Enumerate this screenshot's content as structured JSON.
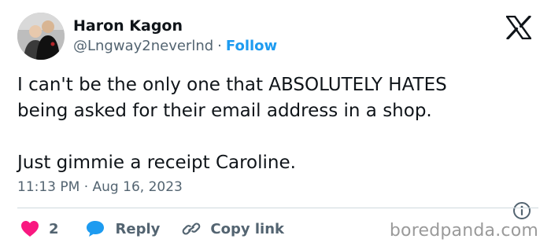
{
  "author": {
    "display_name": "Haron Kagon",
    "handle": "@Lngway2neverlnd",
    "separator": "·",
    "follow_label": "Follow"
  },
  "tweet": {
    "text": "I can't be the only one that ABSOLUTELY HATES\nbeing asked for their email address in a shop.\n\nJust gimmie a receipt Caroline.",
    "timestamp": "11:13 PM · Aug 16, 2023"
  },
  "actions": {
    "like_count": "2",
    "reply_label": "Reply",
    "copy_label": "Copy link"
  },
  "icons": {
    "platform_logo": "x-logo",
    "info": "info-icon",
    "like": "heart-icon",
    "reply": "speech-bubble-icon",
    "copy": "link-icon"
  },
  "colors": {
    "like": "#f91880",
    "reply": "#1d9bf0",
    "follow": "#1d9bf0",
    "secondary_text": "#536471"
  },
  "watermark": "boredpanda.com"
}
